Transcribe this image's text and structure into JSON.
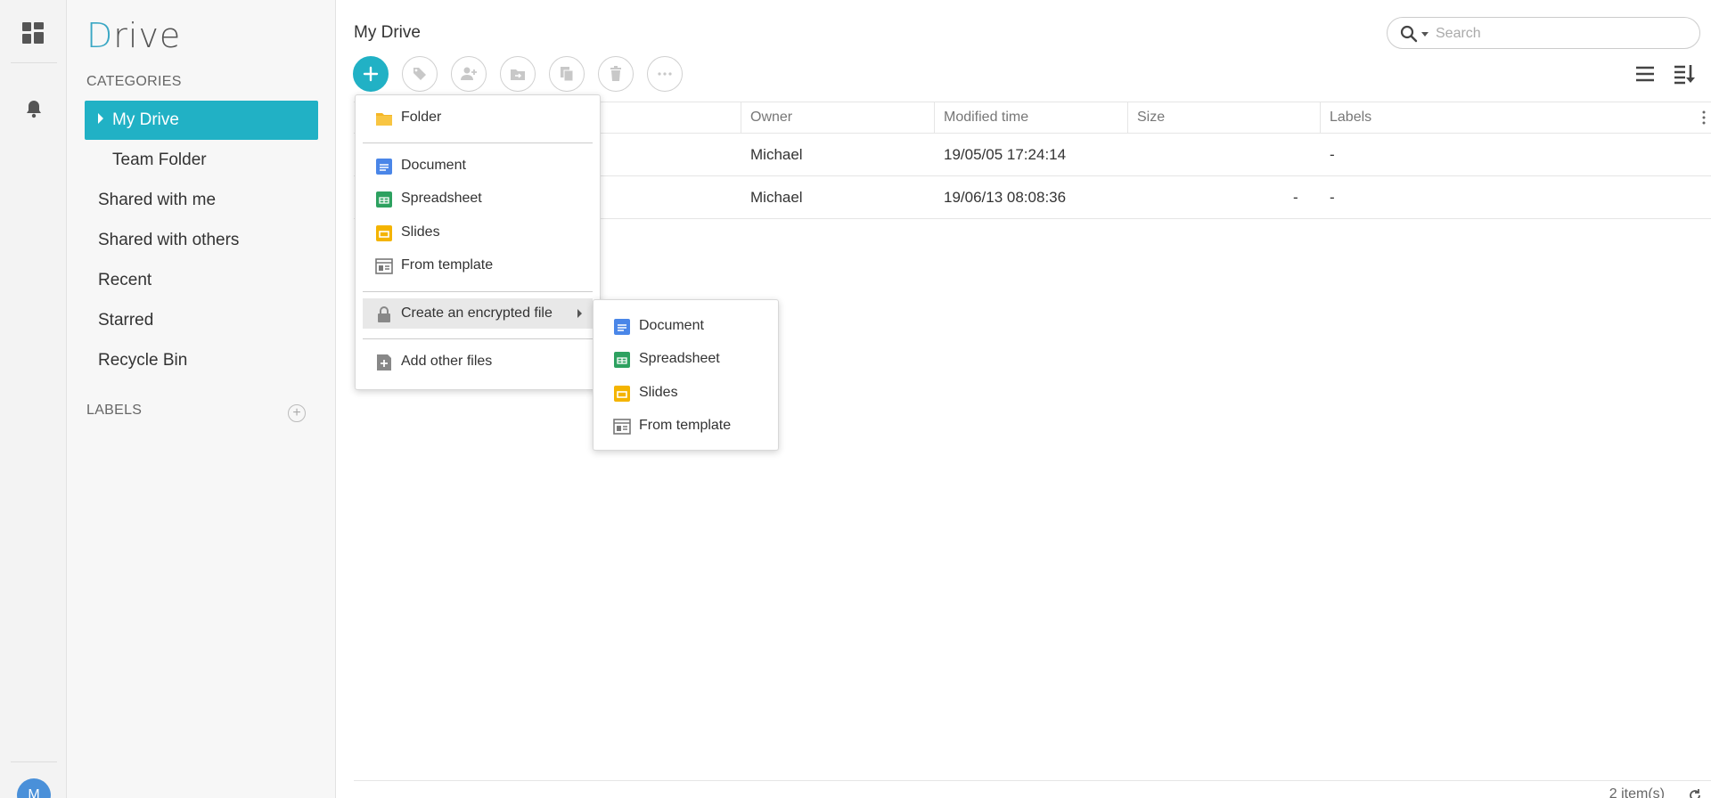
{
  "rail": {
    "avatar_initial": "M"
  },
  "sidebar": {
    "logo_first": "D",
    "logo_rest": "rive",
    "categories_title": "CATEGORIES",
    "labels_title": "LABELS",
    "items": [
      {
        "label": "My Drive"
      },
      {
        "label": "Team Folder"
      },
      {
        "label": "Shared with me"
      },
      {
        "label": "Shared with others"
      },
      {
        "label": "Recent"
      },
      {
        "label": "Starred"
      },
      {
        "label": "Recycle Bin"
      }
    ]
  },
  "header": {
    "title": "My Drive"
  },
  "search": {
    "placeholder": "Search",
    "value": ""
  },
  "table": {
    "columns": [
      {
        "label": "Owner"
      },
      {
        "label": "Modified time"
      },
      {
        "label": "Size"
      },
      {
        "label": "Labels"
      }
    ],
    "rows": [
      {
        "owner": "Michael",
        "modified": "19/05/05 17:24:14",
        "size": "",
        "labels": "-"
      },
      {
        "owner": "Michael",
        "modified": "19/06/13 08:08:36",
        "size": "-",
        "labels": "-"
      }
    ]
  },
  "create_menu": {
    "folder": "Folder",
    "document": "Document",
    "spreadsheet": "Spreadsheet",
    "slides": "Slides",
    "from_template": "From template",
    "encrypted": "Create an encrypted file",
    "add_other": "Add other files"
  },
  "encrypted_menu": {
    "document": "Document",
    "spreadsheet": "Spreadsheet",
    "slides": "Slides",
    "from_template": "From template"
  },
  "footer": {
    "count": "2 item(s)"
  },
  "colors": {
    "accent": "#21b1c5",
    "doc_blue": "#4a86e8",
    "sheet_green": "#2da160",
    "slides_yellow": "#f4b400",
    "folder_yellow": "#f5b626"
  },
  "icons": [
    "apps-icon",
    "bell-icon",
    "search-icon",
    "plus-icon",
    "tag-icon",
    "share-user-icon",
    "move-icon",
    "copy-icon",
    "trash-icon",
    "more-icon",
    "list-view-icon",
    "sort-icon",
    "folder-icon",
    "document-icon",
    "spreadsheet-icon",
    "slides-icon",
    "template-icon",
    "lock-icon",
    "add-file-icon",
    "refresh-icon"
  ]
}
